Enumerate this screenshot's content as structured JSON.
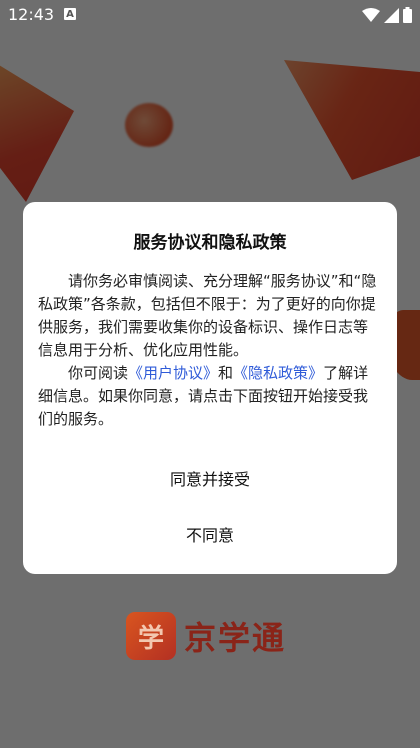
{
  "status_bar": {
    "time": "12:43",
    "notification_badge": "A"
  },
  "dialog": {
    "title": "服务协议和隐私政策",
    "paragraph1": "请你务必审慎阅读、充分理解“服务协议”和“隐私政策”各条款，包括但不限于：为了更好的向你提供服务，我们需要收集你的设备标识、操作日志等信息用于分析、优化应用性能。",
    "p2_prefix": "你可阅读",
    "user_agreement_link": "《用户协议》",
    "p2_and": "和",
    "privacy_policy_link": "《隐私政策》",
    "p2_suffix": "了解详细信息。如果你同意，请点击下面按钮开始接受我们的服务。",
    "agree_label": "同意并接受",
    "disagree_label": "不同意"
  },
  "app_logo": {
    "mark": "学",
    "name": "京学通"
  },
  "colors": {
    "link": "#2f5bd8",
    "brand": "#b33023",
    "overlay": "rgba(0,0,0,0.55)"
  }
}
